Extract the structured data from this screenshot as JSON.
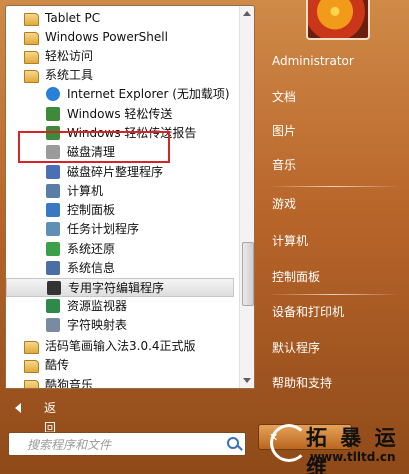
{
  "programs": [
    {
      "label": "Tablet PC",
      "icon": "folder-icon",
      "indent": 0
    },
    {
      "label": "Windows PowerShell",
      "icon": "folder-icon",
      "indent": 0
    },
    {
      "label": "轻松访问",
      "icon": "folder-icon",
      "indent": 0
    },
    {
      "label": "系统工具",
      "icon": "folder-icon",
      "indent": 0
    },
    {
      "label": "Internet Explorer (无加载项)",
      "icon": "internet-explorer-icon",
      "indent": 1
    },
    {
      "label": "Windows 轻松传送",
      "icon": "easy-transfer-icon",
      "indent": 1
    },
    {
      "label": "Windows 轻松传送报告",
      "icon": "easy-transfer-report-icon",
      "indent": 1
    },
    {
      "label": "磁盘清理",
      "icon": "disk-cleanup-icon",
      "indent": 1
    },
    {
      "label": "磁盘碎片整理程序",
      "icon": "defragmenter-icon",
      "indent": 1
    },
    {
      "label": "计算机",
      "icon": "computer-icon",
      "indent": 1
    },
    {
      "label": "控制面板",
      "icon": "control-panel-icon",
      "indent": 1
    },
    {
      "label": "任务计划程序",
      "icon": "task-scheduler-icon",
      "indent": 1
    },
    {
      "label": "系统还原",
      "icon": "system-restore-icon",
      "indent": 1
    },
    {
      "label": "系统信息",
      "icon": "system-info-icon",
      "indent": 1
    },
    {
      "label": "专用字符编辑程序",
      "icon": "char-editor-icon",
      "indent": 1,
      "highlighted": true
    },
    {
      "label": "资源监视器",
      "icon": "resource-monitor-icon",
      "indent": 1
    },
    {
      "label": "字符映射表",
      "icon": "char-map-icon",
      "indent": 1
    },
    {
      "label": "活码笔画输入法3.0.4正式版",
      "icon": "folder-icon",
      "indent": 0
    },
    {
      "label": "酷传",
      "icon": "folder-icon",
      "indent": 0
    },
    {
      "label": "酷狗音乐",
      "icon": "folder-icon",
      "indent": 0
    }
  ],
  "back_label": "返回",
  "search_placeholder": "搜索程序和文件",
  "right_pane": [
    "Administrator",
    "文档",
    "图片",
    "音乐",
    "游戏",
    "计算机",
    "控制面板",
    "设备和打印机",
    "默认程序",
    "帮助和支持"
  ],
  "shutdown_icon": "x-icon",
  "watermark": {
    "title": "拓 暴 运 维",
    "url": "www.tlltd.cn"
  },
  "colors": {
    "menu_bg": "#b8652a",
    "highlight_box": "#d42626"
  }
}
